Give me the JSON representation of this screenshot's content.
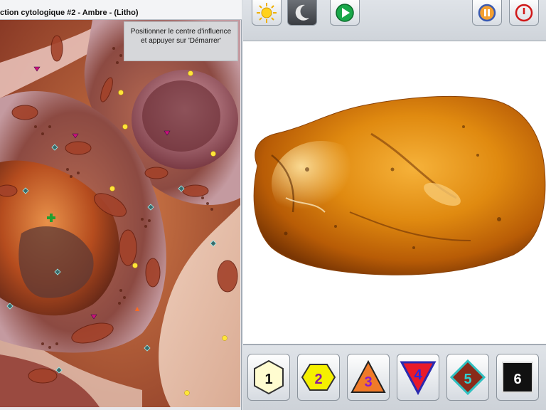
{
  "window": {
    "title": "ction cytologique #2 - Ambre - (Litho)"
  },
  "instruction": {
    "line1": "Positionner le centre d'influence",
    "line2": "et appuyer sur 'Démarrer'"
  },
  "toolbar": {
    "buttons": [
      {
        "icon": "sun-icon"
      },
      {
        "icon": "moon-icon"
      },
      {
        "icon": "play-icon"
      },
      {
        "icon": "sync-icon"
      },
      {
        "icon": "power-icon"
      }
    ]
  },
  "levels": [
    {
      "label": "1",
      "icon": "hexagon-icon",
      "fill": "#fffcd0",
      "stroke": "#333333",
      "text": "#111111"
    },
    {
      "label": "2",
      "icon": "hexagon-icon",
      "fill": "#f5f000",
      "stroke": "#333333",
      "text": "#8a1a9a"
    },
    {
      "label": "3",
      "icon": "triangle-up-icon",
      "fill": "#f07a28",
      "stroke": "#222222",
      "text": "#8a1ad0"
    },
    {
      "label": "4",
      "icon": "triangle-down-icon",
      "fill": "#e81a2a",
      "stroke": "#2a2ab0",
      "text": "#2a2ae0"
    },
    {
      "label": "5",
      "icon": "diamond-icon",
      "fill": "#8a2a1a",
      "stroke": "#30c0c0",
      "text": "#30d0d0"
    },
    {
      "label": "6",
      "icon": "square-icon",
      "fill": "#111111",
      "stroke": "#dddddd",
      "text": "#ffffff"
    }
  ]
}
